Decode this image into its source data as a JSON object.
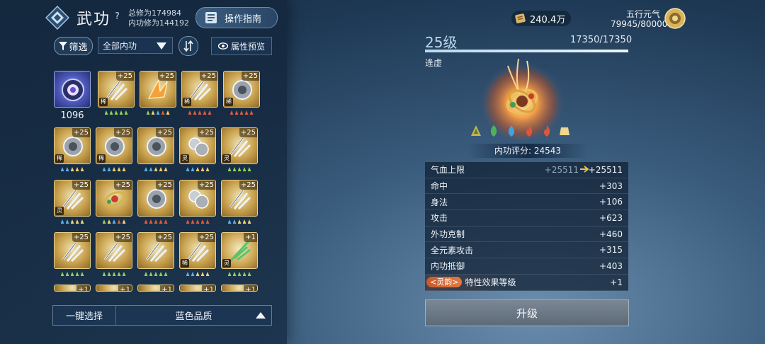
{
  "header": {
    "title": "武功",
    "help_label": "?",
    "total_cultivation": "总修为174984",
    "internal_cultivation": "内功修为144192",
    "guide_label": "操作指南"
  },
  "toolbar": {
    "filter_label": "筛选",
    "dropdown_value": "全部内功",
    "attr_preview_label": "属性预览"
  },
  "grid": {
    "first_item_count": "1096",
    "level_labels": [
      "+25",
      "+25",
      "+25",
      "+25",
      "+25",
      "+25",
      "+25",
      "+25",
      "+25",
      "+25",
      "+25",
      "+25",
      "+25",
      "+25",
      "+25",
      "+25",
      "+25",
      "+25",
      "+1"
    ],
    "rarity_marks": [
      "稀",
      "稀",
      "稀",
      "稀",
      "灵",
      "灵",
      "灵",
      "灵",
      "稀",
      "稀"
    ],
    "partial_row_labels": [
      "+1",
      "+1",
      "+1",
      "+1",
      "+1"
    ]
  },
  "bottom": {
    "one_key_label": "一键选择",
    "quality_label": "蓝色品质"
  },
  "currency": {
    "amount": "240.4万",
    "five_elements_label": "五行元气",
    "five_elements_value": "79945/80000"
  },
  "detail": {
    "level": "25级",
    "exp": "17350/17350",
    "exp_fraction": 1.0,
    "rank": "逄虚",
    "score": "内功评分: 24543"
  },
  "stats": [
    {
      "name": "气血上限",
      "old": "+25511",
      "value": "+25511"
    },
    {
      "name": "命中",
      "value": "+303"
    },
    {
      "name": "身法",
      "value": "+106"
    },
    {
      "name": "攻击",
      "value": "+623"
    },
    {
      "name": "外功克制",
      "value": "+460"
    },
    {
      "name": "全元素攻击",
      "value": "+315"
    },
    {
      "name": "内功抵御",
      "value": "+403"
    }
  ],
  "special": {
    "tag": "<灵韵>",
    "name": "特性效果等级",
    "value": "+1"
  },
  "upgrade_label": "升级",
  "colors": {
    "gold_frame": "#c9a24e",
    "upgrade_button": "#6b7886",
    "exp_bar": "#dcecf6",
    "special_tag": "#d0663a"
  }
}
